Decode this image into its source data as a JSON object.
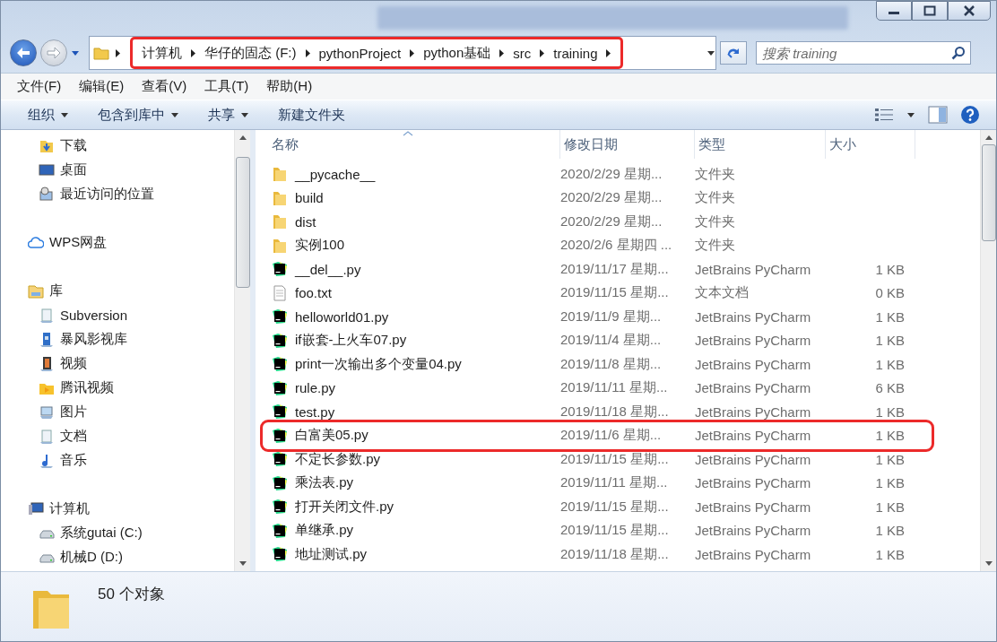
{
  "address_bar": {
    "crumbs": [
      "计算机",
      "华仔的固态 (F:)",
      "pythonProject",
      "python基础",
      "src",
      "training"
    ],
    "highlighted": true
  },
  "search": {
    "placeholder": "搜索 training"
  },
  "menu": [
    "文件(F)",
    "编辑(E)",
    "查看(V)",
    "工具(T)",
    "帮助(H)"
  ],
  "toolbar": [
    {
      "label": "组织",
      "dropdown": true
    },
    {
      "label": "包含到库中",
      "dropdown": true
    },
    {
      "label": "共享",
      "dropdown": true
    },
    {
      "label": "新建文件夹",
      "dropdown": false
    }
  ],
  "sidebar": {
    "sections": [
      {
        "items": [
          {
            "label": "下载",
            "kind": "download"
          },
          {
            "label": "桌面",
            "kind": "desktop"
          },
          {
            "label": "最近访问的位置",
            "kind": "recent"
          }
        ]
      },
      {
        "title": {
          "label": "WPS网盘",
          "kind": "cloud"
        }
      },
      {
        "title": {
          "label": "库",
          "kind": "library"
        },
        "items": [
          {
            "label": "Subversion",
            "kind": "document"
          },
          {
            "label": "暴风影视库",
            "kind": "media"
          },
          {
            "label": "视频",
            "kind": "video"
          },
          {
            "label": "腾讯视频",
            "kind": "folder"
          },
          {
            "label": "图片",
            "kind": "picture"
          },
          {
            "label": "文档",
            "kind": "document"
          },
          {
            "label": "音乐",
            "kind": "music"
          }
        ]
      },
      {
        "title": {
          "label": "计算机",
          "kind": "computer"
        },
        "items": [
          {
            "label": "系统gutai (C:)",
            "kind": "drive"
          },
          {
            "label": "机械D (D:)",
            "kind": "drive"
          }
        ]
      }
    ]
  },
  "table": {
    "columns": [
      {
        "label": "名称",
        "sorted": true
      },
      {
        "label": "修改日期",
        "sorted": false
      },
      {
        "label": "类型",
        "sorted": false
      },
      {
        "label": "大小",
        "sorted": false
      }
    ],
    "rows": [
      {
        "name": "__pycache__",
        "date": "2020/2/29 星期...",
        "type": "文件夹",
        "kind": "folder",
        "highlighted": false
      },
      {
        "name": "build",
        "date": "2020/2/29 星期...",
        "type": "文件夹",
        "kind": "folder",
        "highlighted": false
      },
      {
        "name": "dist",
        "date": "2020/2/29 星期...",
        "type": "文件夹",
        "kind": "folder",
        "highlighted": false
      },
      {
        "name": "实例100",
        "date": "2020/2/6 星期四 ...",
        "type": "文件夹",
        "kind": "folder",
        "highlighted": false
      },
      {
        "name": "__del__.py",
        "date": "2019/11/17 星期...",
        "type": "JetBrains PyCharm",
        "size": "1 KB",
        "kind": "pycharm",
        "highlighted": false
      },
      {
        "name": "foo.txt",
        "date": "2019/11/15 星期...",
        "type": "文本文档",
        "size": "0 KB",
        "kind": "text",
        "highlighted": false
      },
      {
        "name": "helloworld01.py",
        "date": "2019/11/9 星期...",
        "type": "JetBrains PyCharm",
        "size": "1 KB",
        "kind": "pycharm",
        "highlighted": false
      },
      {
        "name": "if嵌套-上火车07.py",
        "date": "2019/11/4 星期...",
        "type": "JetBrains PyCharm",
        "size": "1 KB",
        "kind": "pycharm",
        "highlighted": false
      },
      {
        "name": "print一次输出多个变量04.py",
        "date": "2019/11/8 星期...",
        "type": "JetBrains PyCharm",
        "size": "1 KB",
        "kind": "pycharm",
        "highlighted": false
      },
      {
        "name": "rule.py",
        "date": "2019/11/11 星期...",
        "type": "JetBrains PyCharm",
        "size": "6 KB",
        "kind": "pycharm",
        "highlighted": false
      },
      {
        "name": "test.py",
        "date": "2019/11/18 星期...",
        "type": "JetBrains PyCharm",
        "size": "1 KB",
        "kind": "pycharm",
        "highlighted": false
      },
      {
        "name": "白富美05.py",
        "date": "2019/11/6 星期...",
        "type": "JetBrains PyCharm",
        "size": "1 KB",
        "kind": "pycharm",
        "highlighted": true
      },
      {
        "name": "不定长参数.py",
        "date": "2019/11/15 星期...",
        "type": "JetBrains PyCharm",
        "size": "1 KB",
        "kind": "pycharm",
        "highlighted": false
      },
      {
        "name": "乘法表.py",
        "date": "2019/11/11 星期...",
        "type": "JetBrains PyCharm",
        "size": "1 KB",
        "kind": "pycharm",
        "highlighted": false
      },
      {
        "name": "打开关闭文件.py",
        "date": "2019/11/15 星期...",
        "type": "JetBrains PyCharm",
        "size": "1 KB",
        "kind": "pycharm",
        "highlighted": false
      },
      {
        "name": "单继承.py",
        "date": "2019/11/15 星期...",
        "type": "JetBrains PyCharm",
        "size": "1 KB",
        "kind": "pycharm",
        "highlighted": false
      },
      {
        "name": "地址测试.py",
        "date": "2019/11/18 星期...",
        "type": "JetBrains PyCharm",
        "size": "1 KB",
        "kind": "pycharm",
        "highlighted": false
      }
    ]
  },
  "status_bar": {
    "count": "50 个对象"
  }
}
